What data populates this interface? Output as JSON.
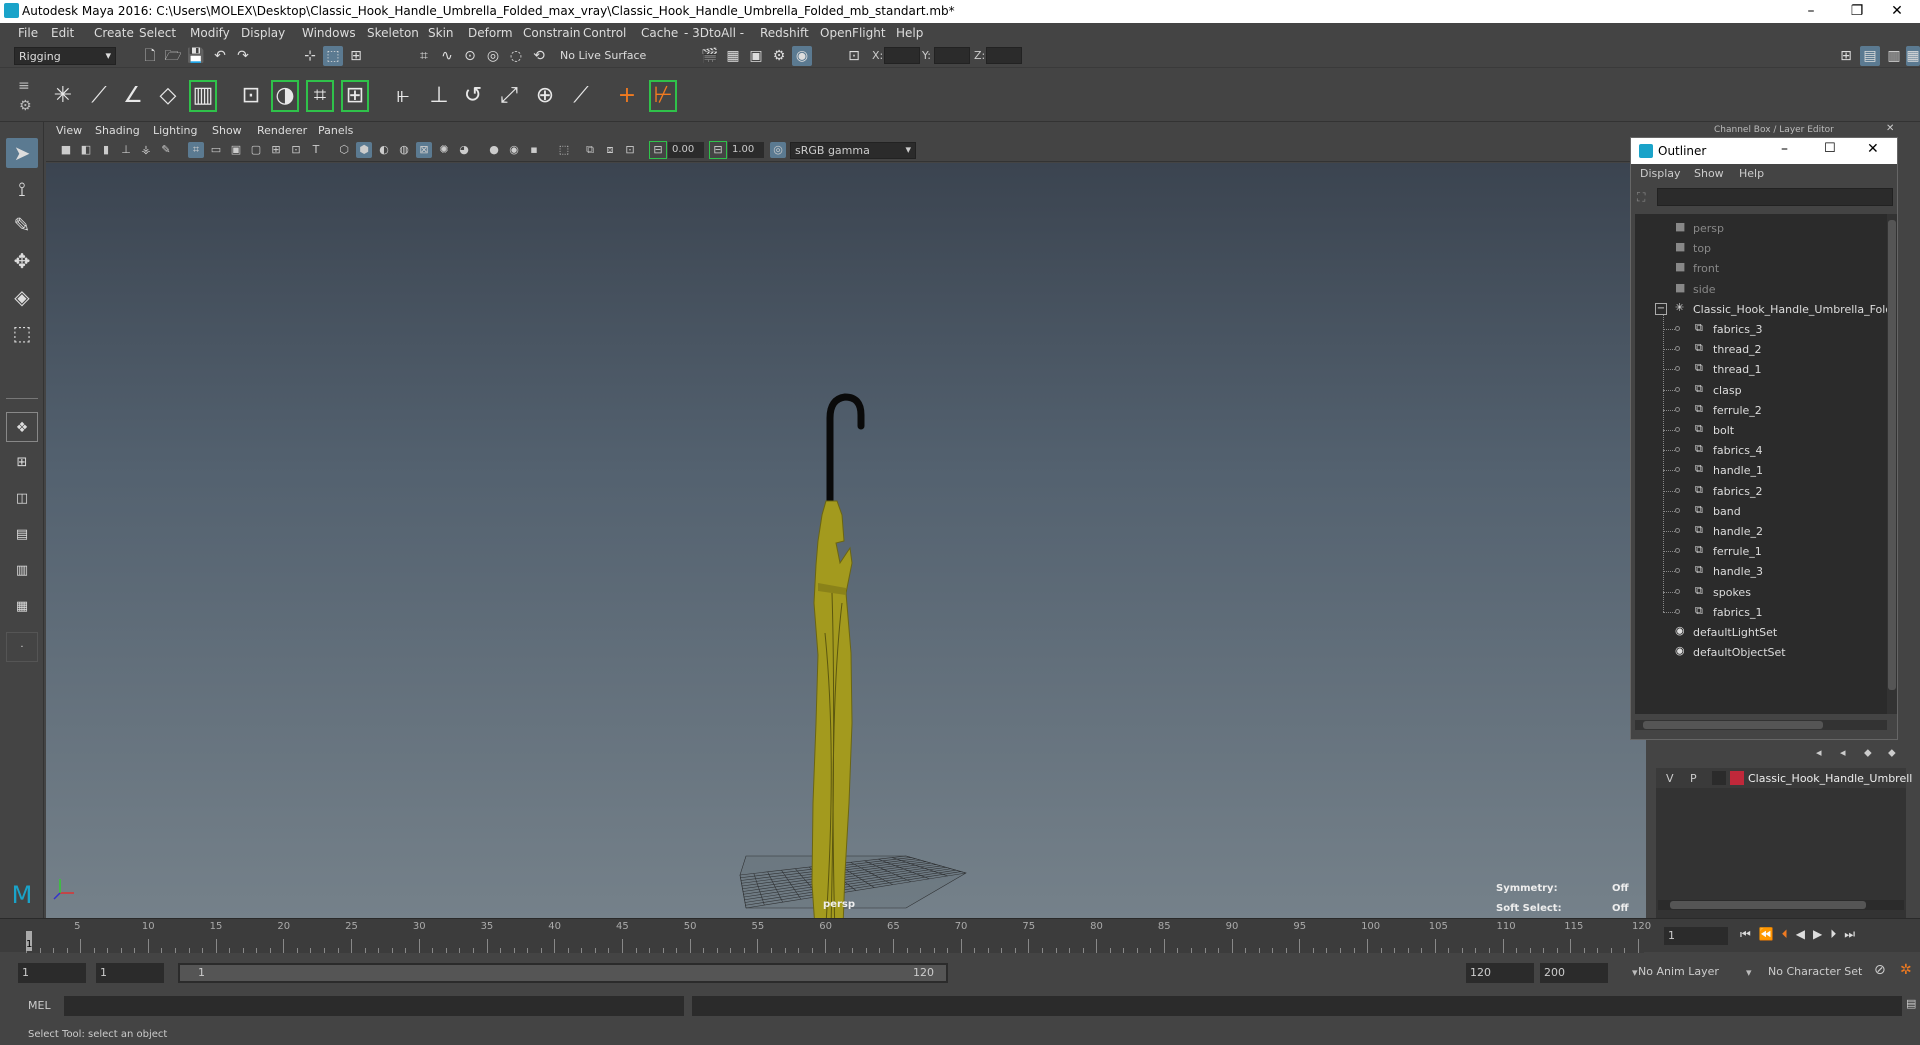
{
  "window": {
    "title": "Autodesk Maya 2016: C:\\Users\\MOLEX\\Desktop\\Classic_Hook_Handle_Umbrella_Folded_max_vray\\Classic_Hook_Handle_Umbrella_Folded_mb_standart.mb*",
    "minimize": "–",
    "restore": "❐",
    "close": "✕"
  },
  "menubar": [
    "File",
    "Edit",
    "Create",
    "Select",
    "Modify",
    "Display",
    "Windows",
    "Skeleton",
    "Skin",
    "Deform",
    "Constrain",
    "Control",
    "Cache",
    "- 3DtoAll -",
    "Redshift",
    "OpenFlight",
    "Help"
  ],
  "statusline": {
    "mode": "Rigging",
    "live_surface": "No Live Surface",
    "x_label": "X:",
    "y_label": "Y:",
    "z_label": "Z:"
  },
  "viewport": {
    "menu": [
      "View",
      "Shading",
      "Lighting",
      "Show",
      "Renderer",
      "Panels"
    ],
    "exposure": "0.00",
    "gamma": "1.00",
    "color_space": "sRGB gamma",
    "camera_label": "persp",
    "symmetry_label": "Symmetry:",
    "symmetry_value": "Off",
    "soft_select_label": "Soft Select:",
    "soft_select_value": "Off"
  },
  "channelbox": {
    "title": "Channel Box / Layer Editor"
  },
  "outliner": {
    "title": "Outliner",
    "menu": [
      "Display",
      "Show",
      "Help"
    ],
    "cameras": [
      "persp",
      "top",
      "front",
      "side"
    ],
    "group": "Classic_Hook_Handle_Umbrella_Folc",
    "children": [
      "fabrics_3",
      "thread_2",
      "thread_1",
      "clasp",
      "ferrule_2",
      "bolt",
      "fabrics_4",
      "handle_1",
      "fabrics_2",
      "band",
      "handle_2",
      "ferrule_1",
      "handle_3",
      "spokes",
      "fabrics_1"
    ],
    "sets": [
      "defaultLightSet",
      "defaultObjectSet"
    ]
  },
  "layer_editor": {
    "v": "V",
    "p": "P",
    "layer_name": "Classic_Hook_Handle_Umbrell",
    "layer_color": "#c0283a"
  },
  "timeline": {
    "ticks": [
      "5",
      "10",
      "15",
      "20",
      "25",
      "30",
      "35",
      "40",
      "45",
      "50",
      "55",
      "60",
      "65",
      "70",
      "75",
      "80",
      "85",
      "90",
      "95",
      "100",
      "105",
      "110",
      "115",
      "120"
    ],
    "first": "1",
    "current_frame": "1"
  },
  "range": {
    "start": "1",
    "anim_start": "1",
    "range_start": "1",
    "range_end": "120",
    "end": "120",
    "anim_end": "200",
    "anim_layer": "No Anim Layer",
    "char_set": "No Character Set"
  },
  "cmdline": {
    "lang": "MEL"
  },
  "help": {
    "text": "Select Tool: select an object"
  },
  "colors": {
    "accent": "#5b7a91",
    "umbrella": "#a39a1e",
    "highlight_green": "#2fc24a"
  }
}
